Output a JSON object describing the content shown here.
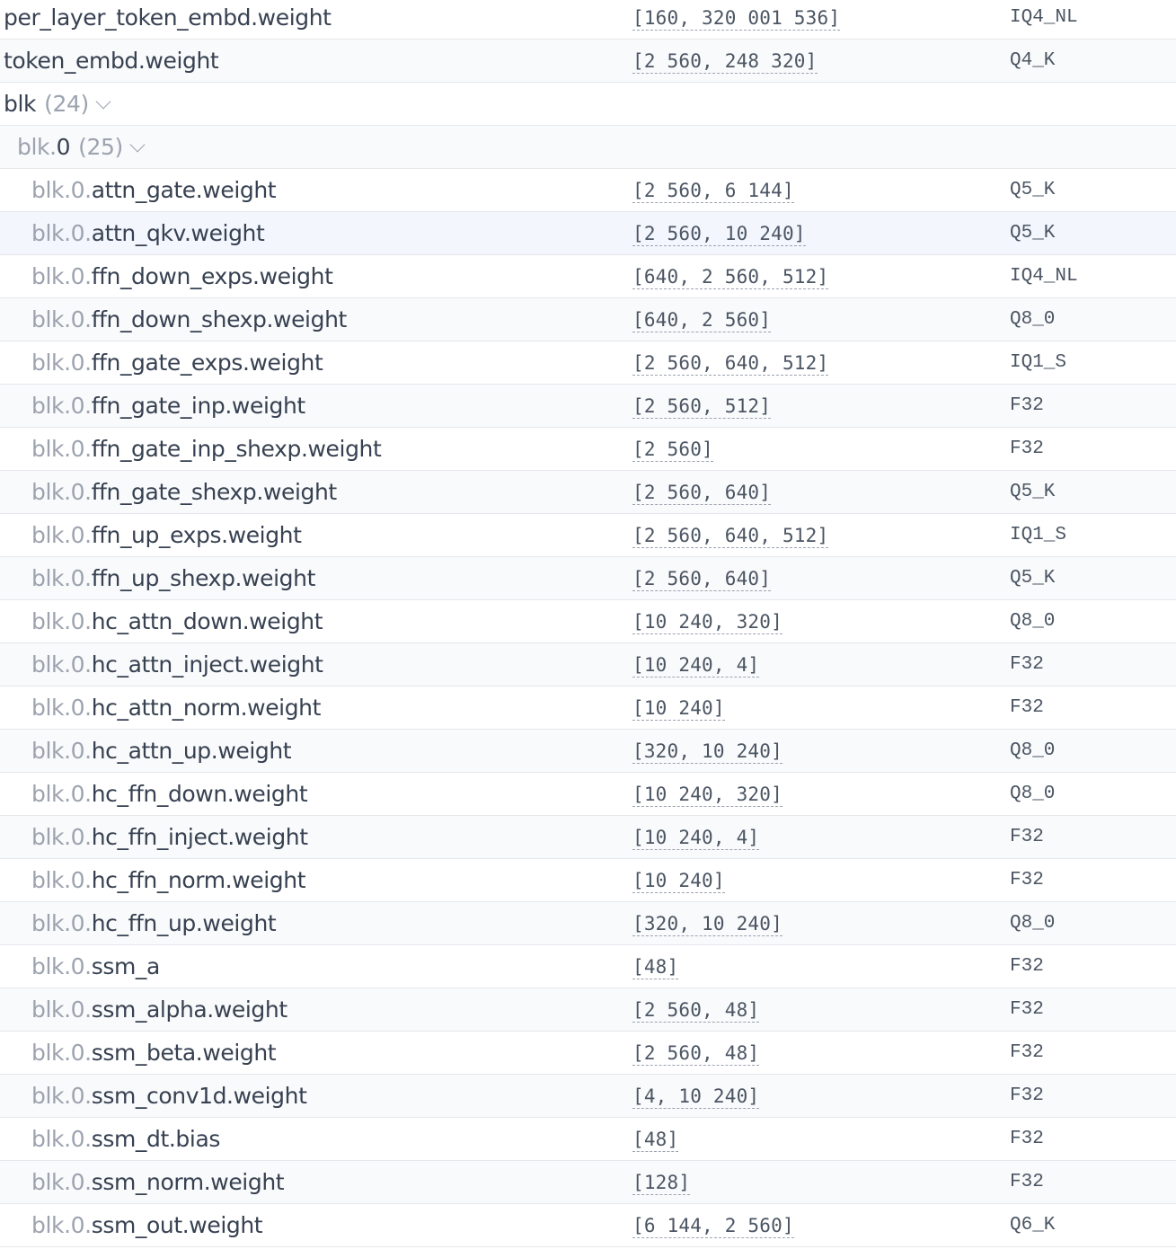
{
  "tensors": [
    {
      "kind": "leaf",
      "level": 0,
      "prefix": "",
      "name": "per_layer_token_embd.weight",
      "shape": "[160, 320 001 536]",
      "type": "IQ4_NL"
    },
    {
      "kind": "leaf",
      "level": 0,
      "prefix": "",
      "name": "token_embd.weight",
      "shape": "[2 560, 248 320]",
      "type": "Q4_K"
    },
    {
      "kind": "group",
      "level": 0,
      "prefix": "",
      "name": "blk",
      "count": "(24)"
    },
    {
      "kind": "group",
      "level": 1,
      "prefix": "blk.",
      "name": "0",
      "count": "(25)"
    },
    {
      "kind": "leaf",
      "level": 2,
      "prefix": "blk.0.",
      "name": "attn_gate.weight",
      "shape": "[2 560, 6 144]",
      "type": "Q5_K"
    },
    {
      "kind": "leaf",
      "level": 2,
      "prefix": "blk.0.",
      "name": "attn_qkv.weight",
      "shape": "[2 560, 10 240]",
      "type": "Q5_K",
      "highlight": true
    },
    {
      "kind": "leaf",
      "level": 2,
      "prefix": "blk.0.",
      "name": "ffn_down_exps.weight",
      "shape": "[640, 2 560, 512]",
      "type": "IQ4_NL"
    },
    {
      "kind": "leaf",
      "level": 2,
      "prefix": "blk.0.",
      "name": "ffn_down_shexp.weight",
      "shape": "[640, 2 560]",
      "type": "Q8_0"
    },
    {
      "kind": "leaf",
      "level": 2,
      "prefix": "blk.0.",
      "name": "ffn_gate_exps.weight",
      "shape": "[2 560, 640, 512]",
      "type": "IQ1_S"
    },
    {
      "kind": "leaf",
      "level": 2,
      "prefix": "blk.0.",
      "name": "ffn_gate_inp.weight",
      "shape": "[2 560, 512]",
      "type": "F32"
    },
    {
      "kind": "leaf",
      "level": 2,
      "prefix": "blk.0.",
      "name": "ffn_gate_inp_shexp.weight",
      "shape": "[2 560]",
      "type": "F32"
    },
    {
      "kind": "leaf",
      "level": 2,
      "prefix": "blk.0.",
      "name": "ffn_gate_shexp.weight",
      "shape": "[2 560, 640]",
      "type": "Q5_K"
    },
    {
      "kind": "leaf",
      "level": 2,
      "prefix": "blk.0.",
      "name": "ffn_up_exps.weight",
      "shape": "[2 560, 640, 512]",
      "type": "IQ1_S"
    },
    {
      "kind": "leaf",
      "level": 2,
      "prefix": "blk.0.",
      "name": "ffn_up_shexp.weight",
      "shape": "[2 560, 640]",
      "type": "Q5_K"
    },
    {
      "kind": "leaf",
      "level": 2,
      "prefix": "blk.0.",
      "name": "hc_attn_down.weight",
      "shape": "[10 240, 320]",
      "type": "Q8_0"
    },
    {
      "kind": "leaf",
      "level": 2,
      "prefix": "blk.0.",
      "name": "hc_attn_inject.weight",
      "shape": "[10 240, 4]",
      "type": "F32"
    },
    {
      "kind": "leaf",
      "level": 2,
      "prefix": "blk.0.",
      "name": "hc_attn_norm.weight",
      "shape": "[10 240]",
      "type": "F32"
    },
    {
      "kind": "leaf",
      "level": 2,
      "prefix": "blk.0.",
      "name": "hc_attn_up.weight",
      "shape": "[320, 10 240]",
      "type": "Q8_0"
    },
    {
      "kind": "leaf",
      "level": 2,
      "prefix": "blk.0.",
      "name": "hc_ffn_down.weight",
      "shape": "[10 240, 320]",
      "type": "Q8_0"
    },
    {
      "kind": "leaf",
      "level": 2,
      "prefix": "blk.0.",
      "name": "hc_ffn_inject.weight",
      "shape": "[10 240, 4]",
      "type": "F32"
    },
    {
      "kind": "leaf",
      "level": 2,
      "prefix": "blk.0.",
      "name": "hc_ffn_norm.weight",
      "shape": "[10 240]",
      "type": "F32"
    },
    {
      "kind": "leaf",
      "level": 2,
      "prefix": "blk.0.",
      "name": "hc_ffn_up.weight",
      "shape": "[320, 10 240]",
      "type": "Q8_0"
    },
    {
      "kind": "leaf",
      "level": 2,
      "prefix": "blk.0.",
      "name": "ssm_a",
      "shape": "[48]",
      "type": "F32"
    },
    {
      "kind": "leaf",
      "level": 2,
      "prefix": "blk.0.",
      "name": "ssm_alpha.weight",
      "shape": "[2 560, 48]",
      "type": "F32"
    },
    {
      "kind": "leaf",
      "level": 2,
      "prefix": "blk.0.",
      "name": "ssm_beta.weight",
      "shape": "[2 560, 48]",
      "type": "F32"
    },
    {
      "kind": "leaf",
      "level": 2,
      "prefix": "blk.0.",
      "name": "ssm_conv1d.weight",
      "shape": "[4, 10 240]",
      "type": "F32"
    },
    {
      "kind": "leaf",
      "level": 2,
      "prefix": "blk.0.",
      "name": "ssm_dt.bias",
      "shape": "[48]",
      "type": "F32"
    },
    {
      "kind": "leaf",
      "level": 2,
      "prefix": "blk.0.",
      "name": "ssm_norm.weight",
      "shape": "[128]",
      "type": "F32"
    },
    {
      "kind": "leaf",
      "level": 2,
      "prefix": "blk.0.",
      "name": "ssm_out.weight",
      "shape": "[6 144, 2 560]",
      "type": "Q6_K"
    }
  ]
}
